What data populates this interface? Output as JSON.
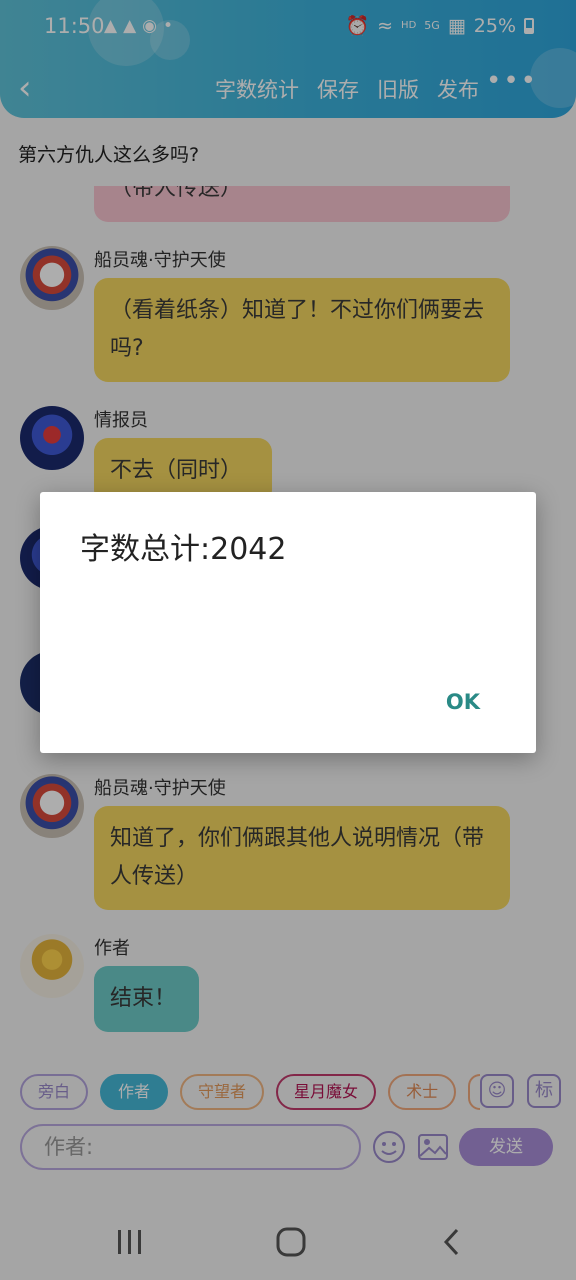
{
  "status_bar": {
    "time": "11:50",
    "battery": "25%",
    "network": "5G",
    "hd": "HD"
  },
  "header": {
    "menu": [
      "字数统计",
      "保存",
      "旧版",
      "发布"
    ]
  },
  "story_title": "第六方仇人这么多吗?",
  "messages": [
    {
      "speaker": "",
      "text": "（带人传送）",
      "style": "pink"
    },
    {
      "speaker": "船员魂·守护天使",
      "text": "（看着纸条）知道了！不过你们俩要去吗?",
      "style": "yellow"
    },
    {
      "speaker": "情报员",
      "text": "不去（同时）",
      "style": "yellow"
    },
    {
      "speaker": "船员魂·守护天使",
      "text": "知道了，你们俩跟其他人说明情况（带人传送）",
      "style": "yellow"
    },
    {
      "speaker": "作者",
      "text": "结束！",
      "style": "teal"
    }
  ],
  "characters": [
    "旁白",
    "作者",
    "守望者",
    "星月魔女",
    "术士"
  ],
  "input": {
    "placeholder": "作者:",
    "send_label": "发送",
    "mark_label": "标"
  },
  "dialog": {
    "message": "字数总计:2042",
    "ok_label": "OK"
  }
}
